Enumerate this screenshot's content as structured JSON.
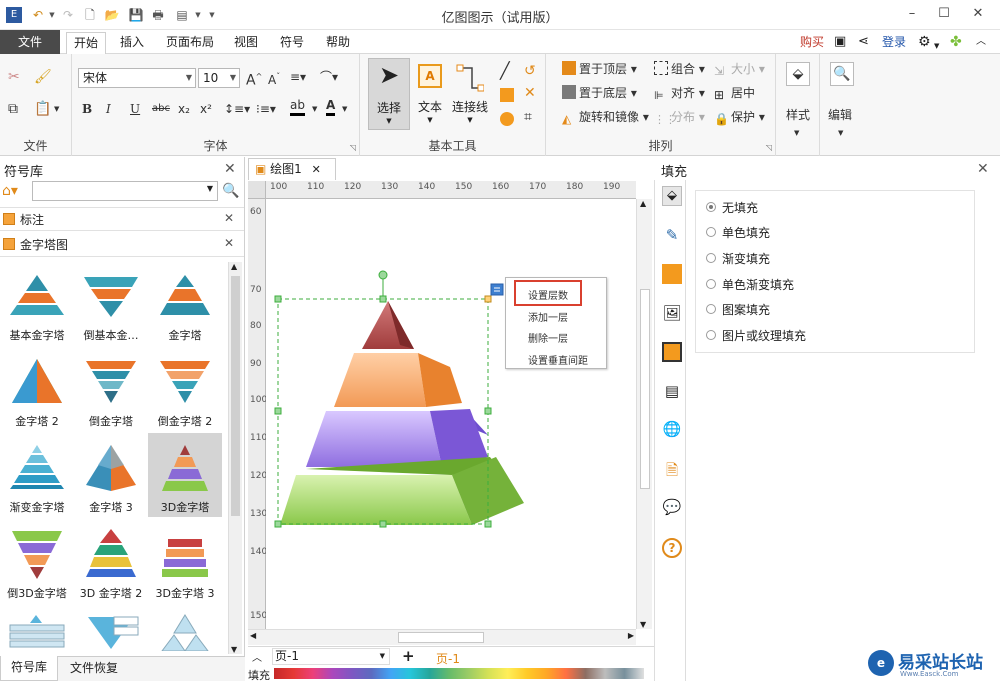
{
  "app": {
    "title": "亿图图示（试用版）"
  },
  "menu": {
    "file": "文件",
    "home": "开始",
    "insert": "插入",
    "layout": "页面布局",
    "view": "视图",
    "symbol": "符号",
    "help": "帮助",
    "buy": "购买",
    "login": "登录"
  },
  "ribbon": {
    "groups": {
      "file": "文件",
      "font": "字体",
      "basic_tools": "基本工具",
      "arrange": "排列"
    },
    "font_name": "宋体",
    "font_size": "10",
    "select": "选择",
    "text": "文本",
    "connector": "连接线",
    "bring_front": "置于顶层",
    "send_back": "置于底层",
    "rotate_mirror": "旋转和镜像",
    "group": "组合",
    "align": "对齐",
    "distribute": "分布",
    "size": "大小",
    "center": "居中",
    "protect": "保护",
    "style": "样式",
    "edit": "编辑",
    "font_btns": {
      "bold": "B",
      "italic": "I",
      "underline": "U",
      "strike": "abc",
      "sub": "x₂",
      "sup": "x²",
      "grow": "A",
      "shrink": "A",
      "color": "A"
    }
  },
  "left_panel": {
    "title": "符号库",
    "categories": [
      "标注",
      "金字塔图"
    ],
    "shapes": [
      {
        "label": "基本金字塔"
      },
      {
        "label": "倒基本金…"
      },
      {
        "label": "金字塔"
      },
      {
        "label": "金字塔 2"
      },
      {
        "label": "倒金字塔"
      },
      {
        "label": "倒金字塔 2"
      },
      {
        "label": "渐变金字塔"
      },
      {
        "label": "金字塔 3"
      },
      {
        "label": "3D金字塔"
      },
      {
        "label": "倒3D金字塔"
      },
      {
        "label": "3D 金字塔 2"
      },
      {
        "label": "3D金字塔 3"
      }
    ],
    "tabs": [
      "符号库",
      "文件恢复"
    ]
  },
  "document": {
    "tab": "绘图1",
    "hruler": [
      "100",
      "110",
      "120",
      "130",
      "140",
      "150",
      "160",
      "170",
      "180",
      "190"
    ],
    "vruler": [
      "60",
      "70",
      "80",
      "90",
      "100",
      "110",
      "120",
      "130",
      "140",
      "150"
    ],
    "page_select": "页-1",
    "page_tab": "页-1",
    "fill_label": "填充"
  },
  "context_menu": {
    "items": [
      "设置层数",
      "添加一层",
      "删除一层",
      "设置垂直间距"
    ]
  },
  "fill_panel": {
    "title": "填充",
    "options": [
      "无填充",
      "单色填充",
      "渐变填充",
      "单色渐变填充",
      "图案填充",
      "图片或纹理填充"
    ],
    "selected_index": 0
  },
  "watermark": {
    "text": "易采站长站",
    "sub": "Www.Easck.Com"
  },
  "colors": {
    "accent": "#d9402f",
    "file_tab": "#4a4a4a",
    "selection": "#3cae3c"
  }
}
